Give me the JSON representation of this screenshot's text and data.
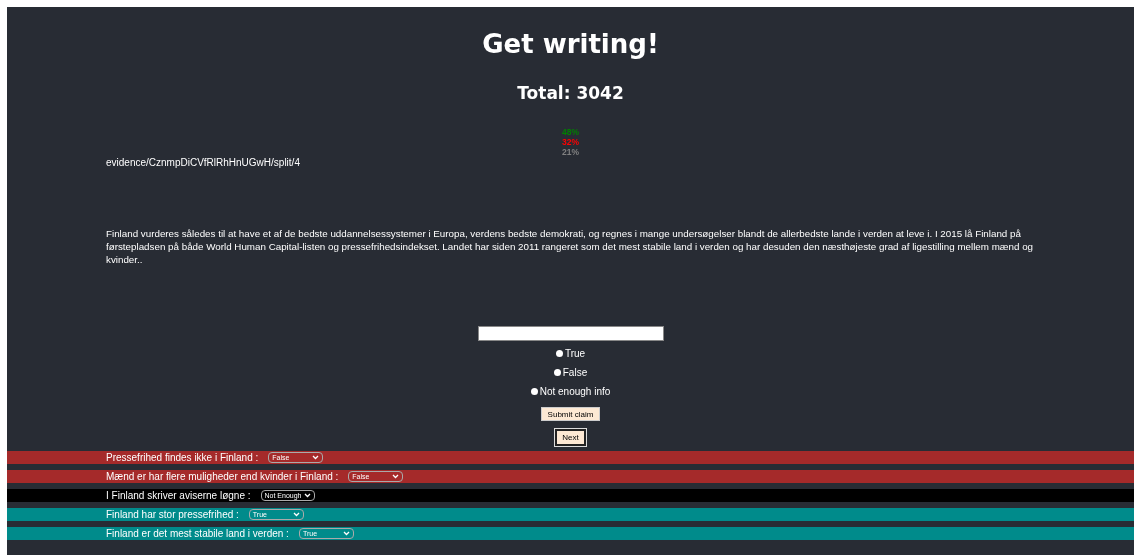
{
  "title": "Get writing!",
  "total": "Total: 3042",
  "percentages": [
    {
      "text": "48%",
      "color": "#008000"
    },
    {
      "text": "32%",
      "color": "#ff0000"
    },
    {
      "text": "21%",
      "color": "#808080"
    }
  ],
  "evidence_path": "evidence/CznmpDiCVfRlRhHnUGwH/split/4",
  "passage": "Finland vurderes således til at have et af de bedste uddannelsessystemer i Europa, verdens bedste demokrati, og regnes i mange undersøgelser blandt de allerbedste lande i verden at leve i. I 2015 lå Finland på førstepladsen på både World Human Capital-listen og pressefrihedsindekset. Landet har siden 2011 rangeret som det mest stabile land i verden og har desuden den næsthøjeste grad af ligestilling mellem mænd og kvinder..",
  "options": [
    {
      "label": "True",
      "selected": false
    },
    {
      "label": "False",
      "selected": false
    },
    {
      "label": "Not enough info",
      "selected": false
    }
  ],
  "buttons": {
    "submit": "Submit claim",
    "next": "Next"
  },
  "claims": [
    {
      "text": "Pressefrihed findes ikke i Finland :",
      "value": "False",
      "color": "#a52a2a"
    },
    {
      "text": "Mænd er har flere muligheder end kvinder i Finland :",
      "value": "False",
      "color": "#a52a2a"
    },
    {
      "text": "I Finland skriver aviserne løgne :",
      "value": "Not Enough",
      "color": "#000000"
    },
    {
      "text": "Finland har stor pressefrihed :",
      "value": "True",
      "color": "#008b8b"
    },
    {
      "text": "Finland er det mest stabile land i verden :",
      "value": "True",
      "color": "#008b8b"
    }
  ]
}
